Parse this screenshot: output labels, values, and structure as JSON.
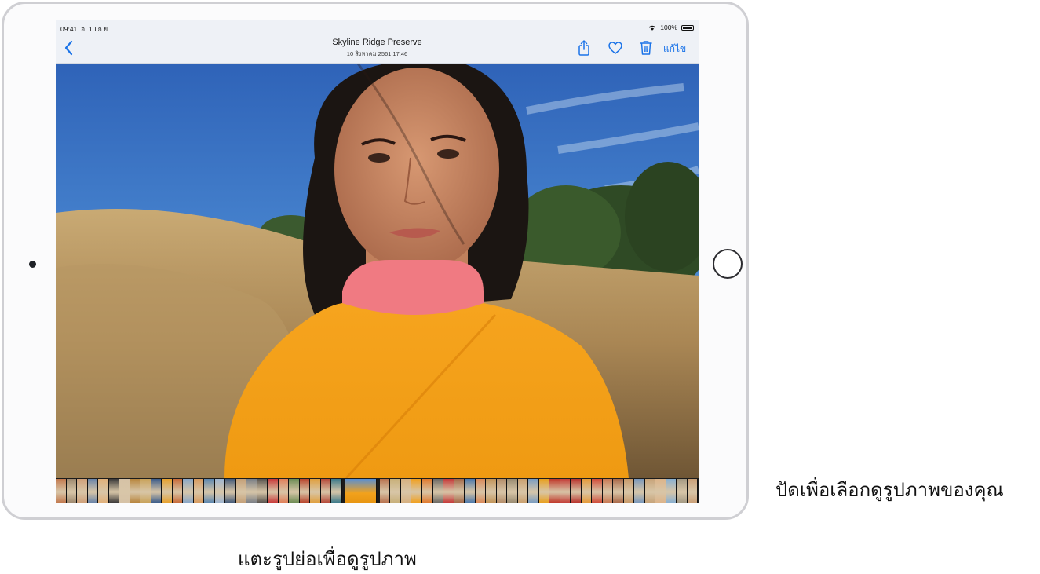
{
  "status_bar": {
    "time": "09:41",
    "date": "อ. 10 ก.ย.",
    "battery": "100%"
  },
  "nav_bar": {
    "title": "Skyline Ridge Preserve",
    "subtitle": "10 สิงหาคม 2561 17:46",
    "edit_label": "แก้ไข",
    "accent_color": "#1a73e8",
    "icons": [
      "back-chevron-icon",
      "share-icon",
      "heart-icon",
      "trash-icon"
    ]
  },
  "filmstrip": {
    "thumb_colors": [
      "#c27a4f",
      "#9f8a70",
      "#cfa07a",
      "#6a84a8",
      "#e0b07a",
      "#3c3a3a",
      "#d6c2a6",
      "#b8863e",
      "#c9a35b",
      "#3d5d8a",
      "#e6a12e",
      "#c86b3a",
      "#8aa7c7",
      "#d79b60",
      "#5e88b0",
      "#9fb5d0",
      "#465c7a",
      "#c4a078",
      "#7a7f86",
      "#5b5650",
      "#c83a3a",
      "#e0805a",
      "#6e8d55",
      "#b8462e",
      "#e0a040",
      "#b64a3a",
      "#3c7a8a",
      "#e9c22a",
      "#b87350",
      "#c8b07a",
      "#d6b080",
      "#f0a020",
      "#e07a2e",
      "#6d6a66",
      "#c53a3a",
      "#a46a4a",
      "#4f79aa",
      "#d98a5a",
      "#c2955a",
      "#b48e6a",
      "#9a8c72",
      "#c9a070",
      "#7a9cc0",
      "#e8a020",
      "#c0392b",
      "#c4403a",
      "#b8342e",
      "#e59a3a",
      "#d14d3a",
      "#c97a55",
      "#aa6a4a",
      "#c89a6a",
      "#7a98bb",
      "#c7a47a",
      "#dcb48a",
      "#8ab0d0",
      "#a49a84",
      "#caa078"
    ],
    "active_index": 27
  },
  "callouts": {
    "swipe": "ปัดเพื่อเลือกดูรูปภาพของคุณ",
    "tap": "แตะรูปย่อเพื่อดูรูปภาพ"
  }
}
